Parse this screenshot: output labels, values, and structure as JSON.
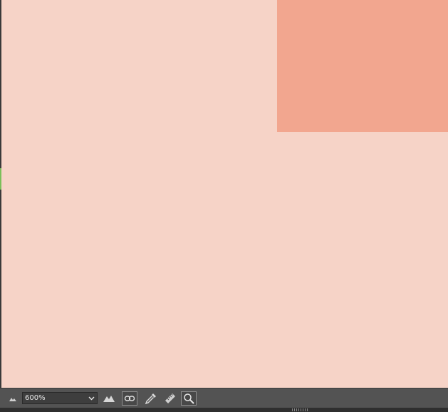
{
  "toolbar": {
    "zoom": {
      "value": "600%"
    },
    "icons": [
      "zoom-out-icon",
      "zoom-in-icon",
      "link-icon",
      "eyedropper-icon",
      "ruler-icon",
      "magnifier-icon"
    ]
  },
  "colors": {
    "canvas_background": "#f6d3c7",
    "swatch_block": "#f2a68f",
    "toolbar": "#535353"
  }
}
